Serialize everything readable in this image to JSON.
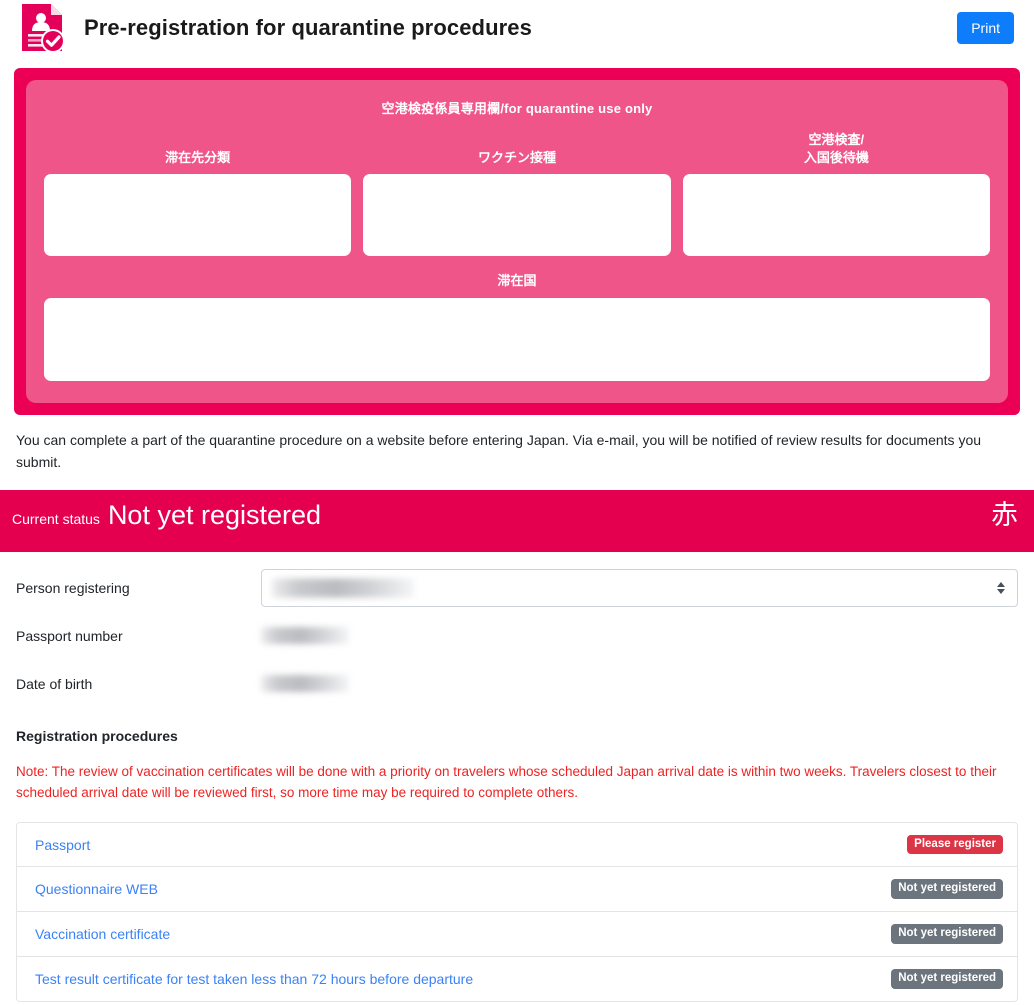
{
  "header": {
    "title": "Pre-registration for quarantine procedures",
    "print_label": "Print",
    "icon": "document-person-check-icon"
  },
  "quarantine_panel": {
    "heading": "空港検疫係員専用欄/for quarantine use only",
    "columns": [
      {
        "label": "滞在先分類",
        "value": ""
      },
      {
        "label": "ワクチン接種",
        "value": ""
      },
      {
        "label": "空港検査/\n入国後待機",
        "value": ""
      }
    ],
    "wide_field": {
      "label": "滞在国",
      "value": ""
    },
    "colors": {
      "outer": "#eb0055",
      "inner": "#f0558a"
    }
  },
  "description": "You can complete a part of the quarantine procedure on a website before entering Japan. Via e-mail, you will be notified of review results for documents you submit.",
  "status_banner": {
    "label": "Current status",
    "value": "Not yet registered",
    "mark": "赤",
    "color": "#e4004f"
  },
  "form": {
    "fields": [
      {
        "label": "Person registering",
        "value": "",
        "type": "select",
        "redacted": true
      },
      {
        "label": "Passport number",
        "value": "",
        "type": "text",
        "redacted": true
      },
      {
        "label": "Date of birth",
        "value": "",
        "type": "text",
        "redacted": true
      }
    ]
  },
  "registration": {
    "section_title": "Registration procedures",
    "note": "Note: The review of vaccination certificates will be done with a priority on travelers whose scheduled Japan arrival date is within two weeks. Travelers closest to their scheduled arrival date will be reviewed first, so more time may be required to complete others.",
    "items": [
      {
        "label": "Passport",
        "status": "Please register",
        "status_type": "danger"
      },
      {
        "label": "Questionnaire WEB",
        "status": "Not yet registered",
        "status_type": "secondary"
      },
      {
        "label": "Vaccination certificate",
        "status": "Not yet registered",
        "status_type": "secondary"
      },
      {
        "label": "Test result certificate for test taken less than 72 hours before departure",
        "status": "Not yet registered",
        "status_type": "secondary"
      }
    ]
  },
  "colors": {
    "accent_pink": "#e4004f",
    "link_blue": "#3b82f6",
    "button_blue": "#0d7dfc",
    "note_red": "#ee2222",
    "badge_danger": "#dc3545",
    "badge_secondary": "#6c757d"
  }
}
